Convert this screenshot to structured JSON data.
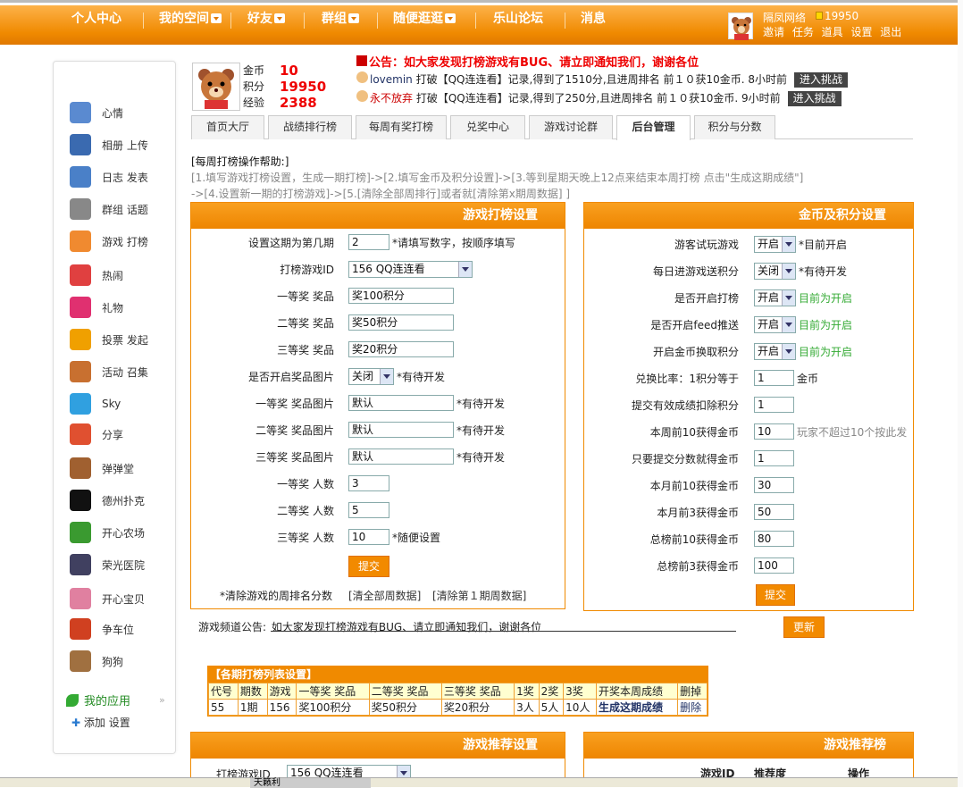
{
  "nav": {
    "items": [
      "个人中心",
      "我的空间",
      "好友",
      "群组",
      "随便逛逛",
      "乐山论坛",
      "消息"
    ],
    "dropdown": [
      false,
      true,
      true,
      true,
      true,
      false,
      false
    ],
    "user": "隔凤网络",
    "coins": "19950",
    "links": "邀请 任务 道具 设置 退出"
  },
  "sidebar": {
    "items": [
      {
        "label": "心情",
        "icon": "mood-icon",
        "color": "#5a8ad0"
      },
      {
        "label": "相册  上传",
        "icon": "photo-album-icon",
        "color": "#3a6ab0"
      },
      {
        "label": "日志  发表",
        "icon": "blog-icon",
        "color": "#4a80c8"
      },
      {
        "label": "群组  话题",
        "icon": "group-icon",
        "color": "#888"
      },
      {
        "label": "游戏  打榜",
        "icon": "game-icon",
        "color": "#f08a30"
      },
      {
        "label": "热闹",
        "icon": "lively-icon",
        "color": "#e04040"
      },
      {
        "label": "礼物",
        "icon": "gift-icon",
        "color": "#e03070"
      },
      {
        "label": "投票  发起",
        "icon": "poll-icon",
        "color": "#f0a000"
      },
      {
        "label": "活动  召集",
        "icon": "event-icon",
        "color": "#c87030"
      },
      {
        "label": "Sky",
        "icon": "sky-icon",
        "color": "#30a0e0"
      },
      {
        "label": "分享",
        "icon": "share-icon",
        "color": "#e05030"
      },
      {
        "label": "弹弹堂",
        "icon": "ddtank-icon",
        "color": "#a06030"
      },
      {
        "label": "德州扑克",
        "icon": "spade-icon",
        "color": "#111"
      },
      {
        "label": "开心农场",
        "icon": "farm-icon",
        "color": "#3a9a30"
      },
      {
        "label": "荣光医院",
        "icon": "hospital-icon",
        "color": "#404060"
      },
      {
        "label": "开心宝贝",
        "icon": "pet-icon",
        "color": "#e080a0"
      },
      {
        "label": "争车位",
        "icon": "parking-icon",
        "color": "#d04020"
      },
      {
        "label": "狗狗",
        "icon": "dog-icon",
        "color": "#a07040"
      }
    ],
    "myapps": "我的应用",
    "footer": "添加   设置"
  },
  "profile": {
    "coin_label": "金币",
    "coin": "10",
    "score_label": "积分",
    "score": "19950",
    "exp_label": "经验",
    "exp": "2388"
  },
  "notice": {
    "headline": "公告：如大家发现打榜游戏有BUG、请立即通知我们，谢谢各位",
    "lines": [
      {
        "user": "lovemin",
        "text": " 打破【QQ连连看】记录,得到了1510分,且进周排名 前１０获10金币.   8小时前",
        "btn": "进入挑战"
      },
      {
        "user": "永不放弃",
        "text": " 打破【QQ连连看】记录,得到了250分,且进周排名 前１０获10金币.   9小时前",
        "btn": "进入挑战"
      }
    ]
  },
  "tabs": [
    "首页大厅",
    "战绩排行榜",
    "每周有奖打榜",
    "兑奖中心",
    "游戏讨论群",
    "后台管理",
    "积分与分数"
  ],
  "help": {
    "title": "[每周打榜操作帮助:]",
    "line1": "[1.填写游戏打榜设置，生成一期打榜]->[2.填写金币及积分设置]->[3.等到星期天晚上12点来结束本周打榜 点击\"生成这期成绩\"]",
    "line2": "->[4.设置新一期的打榜游戏]->[5.[清除全部周排行]或者就[清除第x期周数据] ]"
  },
  "game_settings": {
    "title": "游戏打榜设置",
    "rows": [
      {
        "label": "设置这期为第几期",
        "value": "2",
        "note": "*请填写数字，按顺序填写",
        "type": "input-s"
      },
      {
        "label": "打榜游戏ID",
        "value": "156 QQ连连看",
        "note": "",
        "type": "select-l"
      },
      {
        "label": "一等奖  奖品",
        "value": "奖100积分",
        "note": "",
        "type": "input-l"
      },
      {
        "label": "二等奖  奖品",
        "value": "奖50积分",
        "note": "",
        "type": "input-l"
      },
      {
        "label": "三等奖  奖品",
        "value": "奖20积分",
        "note": "",
        "type": "input-l"
      },
      {
        "label": "是否开启奖品图片",
        "value": "关闭",
        "note": "*有待开发",
        "type": "select-s"
      },
      {
        "label": "一等奖  奖品图片",
        "value": "默认",
        "note": "*有待开发",
        "type": "input-l"
      },
      {
        "label": "二等奖  奖品图片",
        "value": "默认",
        "note": "*有待开发",
        "type": "input-l"
      },
      {
        "label": "三等奖  奖品图片",
        "value": "默认",
        "note": "*有待开发",
        "type": "input-l"
      },
      {
        "label": "一等奖  人数",
        "value": "3",
        "note": "",
        "type": "input-m"
      },
      {
        "label": "二等奖  人数",
        "value": "5",
        "note": "",
        "type": "input-m"
      },
      {
        "label": "三等奖  人数",
        "value": "10",
        "note": "*随便设置",
        "type": "input-m"
      }
    ],
    "submit": "提交",
    "clear_label": "*清除游戏的周排名分数",
    "clear_all": "[清全部周数据]",
    "clear_one": "[清除第１期周数据]"
  },
  "coin_settings": {
    "title": "金币及积分设置",
    "rows": [
      {
        "label": "游客试玩游戏",
        "value": "开启",
        "note": "*目前开启",
        "type": "select",
        "green": false
      },
      {
        "label": "每日进游戏送积分",
        "value": "关闭",
        "note": "*有待开发",
        "type": "select",
        "green": false
      },
      {
        "label": "是否开启打榜",
        "value": "开启",
        "note": "目前为开启",
        "type": "select",
        "green": true
      },
      {
        "label": "是否开启feed推送",
        "value": "开启",
        "note": "目前为开启",
        "type": "select",
        "green": true
      },
      {
        "label": "开启金币换取积分",
        "value": "开启",
        "note": "目前为开启",
        "type": "select",
        "green": true
      },
      {
        "label": "兑换比率：1积分等于",
        "value": "1",
        "note": "金币",
        "type": "input",
        "green": false
      },
      {
        "label": "提交有效成绩扣除积分",
        "value": "1",
        "note": "",
        "type": "input",
        "green": false
      },
      {
        "label": "本周前10获得金币",
        "value": "10",
        "note": "玩家不超过10个按此发",
        "type": "input",
        "green": false
      },
      {
        "label": "只要提交分数就得金币",
        "value": "1",
        "note": "",
        "type": "input",
        "green": false
      },
      {
        "label": "本月前10获得金币",
        "value": "30",
        "note": "",
        "type": "input",
        "green": false
      },
      {
        "label": "本月前3获得金币",
        "value": "50",
        "note": "",
        "type": "input",
        "green": false
      },
      {
        "label": "总榜前10获得金币",
        "value": "80",
        "note": "",
        "type": "input",
        "green": false
      },
      {
        "label": "总榜前3获得金币",
        "value": "100",
        "note": "",
        "type": "input",
        "green": false
      }
    ],
    "submit": "提交"
  },
  "channel": {
    "label": "游戏频道公告:",
    "text": "如大家发现打榜游戏有BUG、请立即通知我们，谢谢各位",
    "update": "更新"
  },
  "list_table": {
    "title": "【各期打榜列表设置】",
    "headers": [
      "代号",
      "期数",
      "游戏",
      "一等奖  奖品",
      "二等奖  奖品",
      "三等奖  奖品",
      "1奖",
      "2奖",
      "3奖",
      "开奖本周成绩",
      "删掉"
    ],
    "rows": [
      [
        "55",
        "1期",
        "156",
        "奖100积分",
        "奖50积分",
        "奖20积分",
        "3人",
        "5人",
        "10人",
        "生成这期成绩",
        "删除"
      ]
    ]
  },
  "rec_settings": {
    "title": "游戏推荐设置",
    "row_label": "打榜游戏ID",
    "row_value": "156 QQ连连看"
  },
  "rec_board": {
    "title": "游戏推荐榜",
    "headers": [
      "游戏ID",
      "推荐度",
      "操作"
    ]
  },
  "taskbar": {
    "item": "天籁利"
  }
}
